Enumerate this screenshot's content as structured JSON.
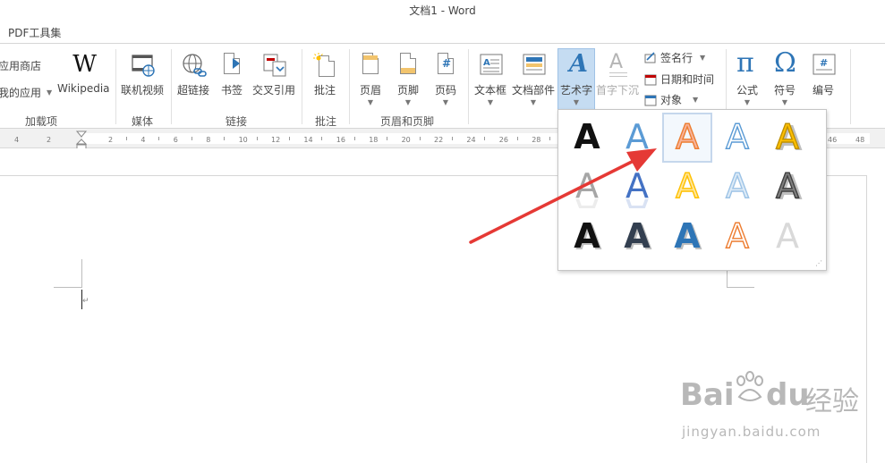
{
  "window": {
    "title": "文档1 - Word"
  },
  "tabs": [
    {
      "label": "PDF工具集"
    }
  ],
  "ribbon": {
    "addins": {
      "app_store": "应用商店",
      "my_apps": "我的应用",
      "wikipedia": "Wikipedia",
      "wikipedia_glyph": "W",
      "group_label": "加载项"
    },
    "media": {
      "online_video": "联机视频",
      "group_label": "媒体"
    },
    "links": {
      "hyperlink": "超链接",
      "bookmark": "书签",
      "cross_ref": "交叉引用",
      "group_label": "链接"
    },
    "comments": {
      "comment": "批注",
      "group_label": "批注"
    },
    "header_footer": {
      "header": "页眉",
      "footer": "页脚",
      "page_number": "页码",
      "group_label": "页眉和页脚"
    },
    "text": {
      "text_box": "文本框",
      "quick_parts": "文档部件",
      "wordart": "艺术字",
      "drop_cap": "首字下沉",
      "signature_line": "签名行",
      "date_time": "日期和时间",
      "object": "对象"
    },
    "symbols": {
      "equation": "公式",
      "equation_glyph": "π",
      "symbol": "符号",
      "symbol_glyph": "Ω",
      "numbering": "编号",
      "numbering_glyph": "#"
    }
  },
  "ruler": {
    "left_ticks": [
      "4",
      "2"
    ],
    "ticks": [
      "2",
      "4",
      "6",
      "8",
      "10",
      "12",
      "14",
      "16",
      "18",
      "20",
      "22",
      "24",
      "26",
      "28"
    ],
    "right_ticks": [
      "46",
      "48"
    ]
  },
  "document": {
    "paragraph_mark": "↵"
  },
  "gallery": {
    "glyph": "A",
    "styles": [
      {
        "fill": "#111111",
        "stroke": "none",
        "style": "plain"
      },
      {
        "fill": "#5b9bd5",
        "stroke": "none",
        "style": "gradient-blue"
      },
      {
        "fill": "#f7b49a",
        "stroke": "#ed7d31",
        "style": "outline-orange"
      },
      {
        "fill": "#ffffff",
        "stroke": "#5b9bd5",
        "style": "outline-blue"
      },
      {
        "fill": "#ffc000",
        "stroke": "#bf9000",
        "style": "gold"
      },
      {
        "fill": "#a6a6a6",
        "stroke": "none",
        "style": "gray-reflection"
      },
      {
        "fill": "#4472c4",
        "stroke": "none",
        "style": "blue-reflection"
      },
      {
        "fill": "#ffe699",
        "stroke": "#ffc000",
        "style": "yellow-outline"
      },
      {
        "fill": "#ddebf7",
        "stroke": "#9dc3e6",
        "style": "lightblue-outline"
      },
      {
        "fill": "#7f7f7f",
        "stroke": "#404040",
        "style": "gray-bevel"
      },
      {
        "fill": "#111111",
        "stroke": "none",
        "style": "black-shadow"
      },
      {
        "fill": "#333f50",
        "stroke": "none",
        "style": "navy-shadow"
      },
      {
        "fill": "#2e75b6",
        "stroke": "none",
        "style": "blue-shadow"
      },
      {
        "fill": "#ffffff",
        "stroke": "#ed7d31",
        "style": "white-orange-outline"
      },
      {
        "fill": "#d9d9d9",
        "stroke": "none",
        "style": "silver"
      }
    ]
  },
  "watermark": {
    "brand": "Bai",
    "brand2": "du",
    "brand_cn": "经验",
    "url": "jingyan.baidu.com"
  },
  "colors": {
    "accent": "#2b579a",
    "arrow": "#e53935",
    "wordart_selected_bg": "#dce8f5"
  }
}
